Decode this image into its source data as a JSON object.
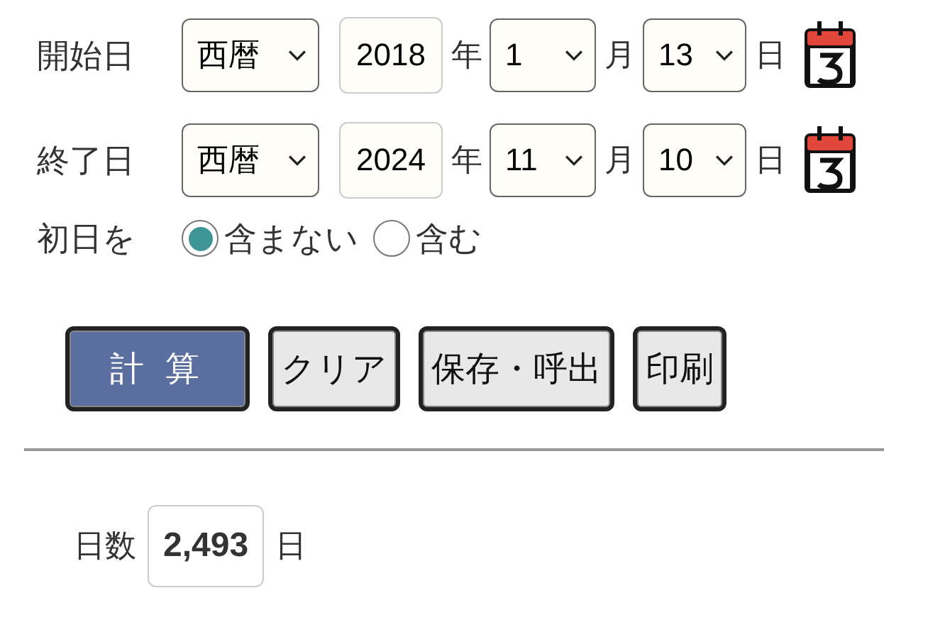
{
  "date_rows": [
    {
      "label": "開始日",
      "era": "西暦",
      "year": "2018",
      "year_unit": "年",
      "month": "1",
      "month_unit": "月",
      "day": "13",
      "day_unit": "日"
    },
    {
      "label": "終了日",
      "era": "西暦",
      "year": "2024",
      "year_unit": "年",
      "month": "11",
      "month_unit": "月",
      "day": "10",
      "day_unit": "日"
    }
  ],
  "first_day": {
    "label": "初日を",
    "options": [
      {
        "label": "含まない",
        "selected": true
      },
      {
        "label": "含む",
        "selected": false
      }
    ]
  },
  "buttons": [
    {
      "label": "計 算",
      "kind": "primary"
    },
    {
      "label": "クリア",
      "kind": "normal"
    },
    {
      "label": "保存・呼出",
      "kind": "normal"
    },
    {
      "label": "印刷",
      "kind": "normal"
    }
  ],
  "result": {
    "label": "日数",
    "value": "2,493",
    "unit": "日"
  }
}
